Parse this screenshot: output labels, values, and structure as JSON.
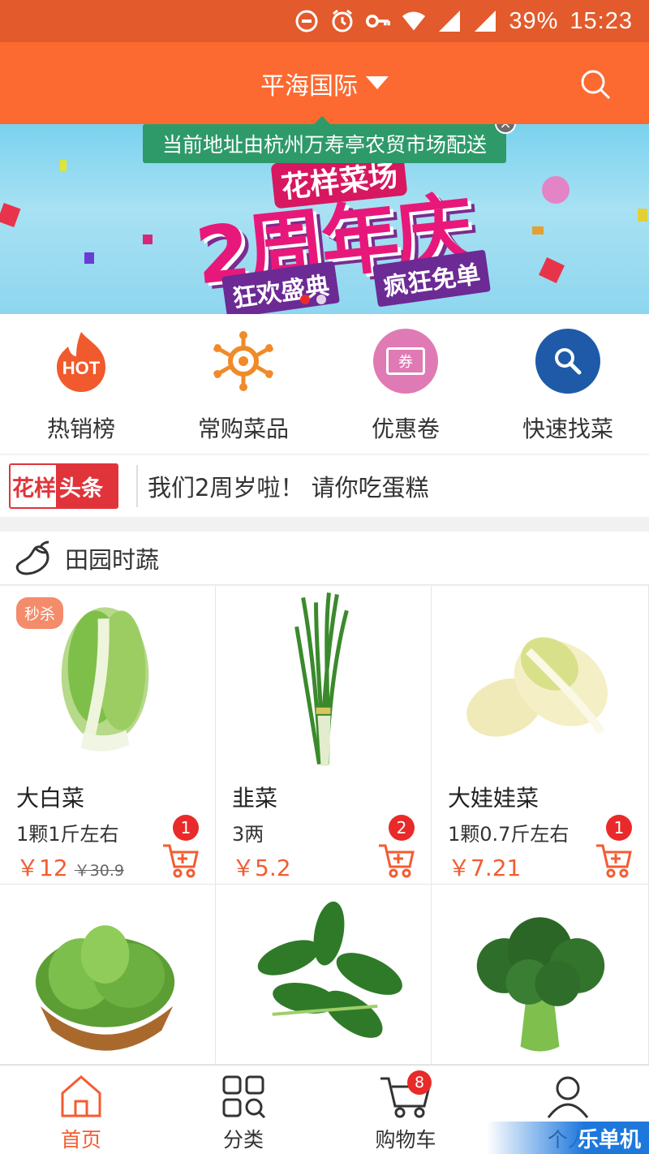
{
  "status_bar": {
    "battery": "39%",
    "time": "15:23"
  },
  "header": {
    "location": "平海国际"
  },
  "banner": {
    "tooltip": "当前地址由杭州万寿亭农贸市场配送",
    "promo_sub": "花样菜场",
    "promo_main": "2周年庆",
    "promo_left": "狂欢盛典",
    "promo_right": "疯狂免单"
  },
  "quick_nav": [
    {
      "label": "热销榜",
      "icon": "hot-icon",
      "color": "#f05a2c"
    },
    {
      "label": "常购菜品",
      "icon": "sheriff-star-icon",
      "color": "#f08a2a"
    },
    {
      "label": "优惠卷",
      "icon": "coupon-icon",
      "color": "#e07ab4",
      "icon_text": "券"
    },
    {
      "label": "快速找菜",
      "icon": "search-icon",
      "color": "#1e5aa8"
    }
  ],
  "news": {
    "badge_a": "花样",
    "badge_b": "头条",
    "text": "我们2周岁啦！ 请你吃蛋糕"
  },
  "section": {
    "title": "田园时蔬",
    "icon": "eggplant-icon"
  },
  "products": [
    {
      "name": "大白菜",
      "spec": "1颗1斤左右",
      "price": "￥12",
      "orig": "￥30.9",
      "count": "1",
      "tag": "秒杀"
    },
    {
      "name": "韭菜",
      "spec": "3两",
      "price": "￥5.2",
      "count": "2"
    },
    {
      "name": "大娃娃菜",
      "spec": "1颗0.7斤左右",
      "price": "￥7.21",
      "count": "1"
    }
  ],
  "bottom_nav": {
    "home": "首页",
    "category": "分类",
    "cart": "购物车",
    "cart_count": "8",
    "me": "个人",
    "watermark": "乐单机"
  },
  "colors": {
    "primary": "#fc6a31",
    "status": "#e35a2c",
    "price": "#f35c31",
    "badge": "#e92a2a"
  }
}
